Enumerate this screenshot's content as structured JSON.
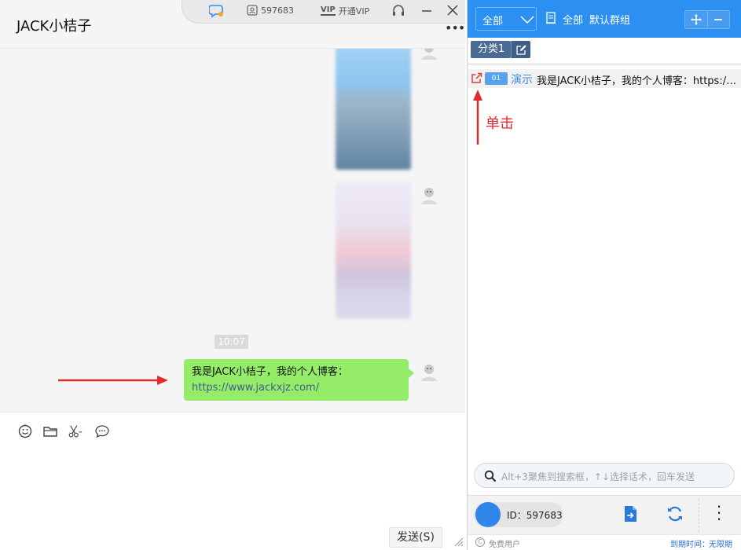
{
  "chat": {
    "title": "JACK小桔子",
    "time": "10:07",
    "message_prefix": "我是JACK小桔子，我的个人博客：",
    "message_link": "https://www.jackxjz.com/",
    "send_label": "发送(S)"
  },
  "floatbar": {
    "account_id": "597683",
    "vip_label": "开通VIP"
  },
  "panel": {
    "scope_select": "全部",
    "scope_label": "全部",
    "group_label": "默认群组",
    "category_tab": "分类1",
    "script": {
      "number": "01",
      "tag": "演示",
      "text": "我是JACK小桔子，我的个人博客：https://www.jackxjz.com/"
    },
    "annotation": "单击",
    "search_placeholder": "Alt+3聚焦到搜索框，↑↓选择话术，回车发送",
    "user_id": "ID：597683",
    "user_type": "免费用户",
    "expire_label": "到期时间：",
    "expire_value": "无限期"
  },
  "colors": {
    "accent_blue": "#2c8ff2",
    "bubble_green": "#95ec69",
    "annotation_red": "#e02b2b"
  }
}
